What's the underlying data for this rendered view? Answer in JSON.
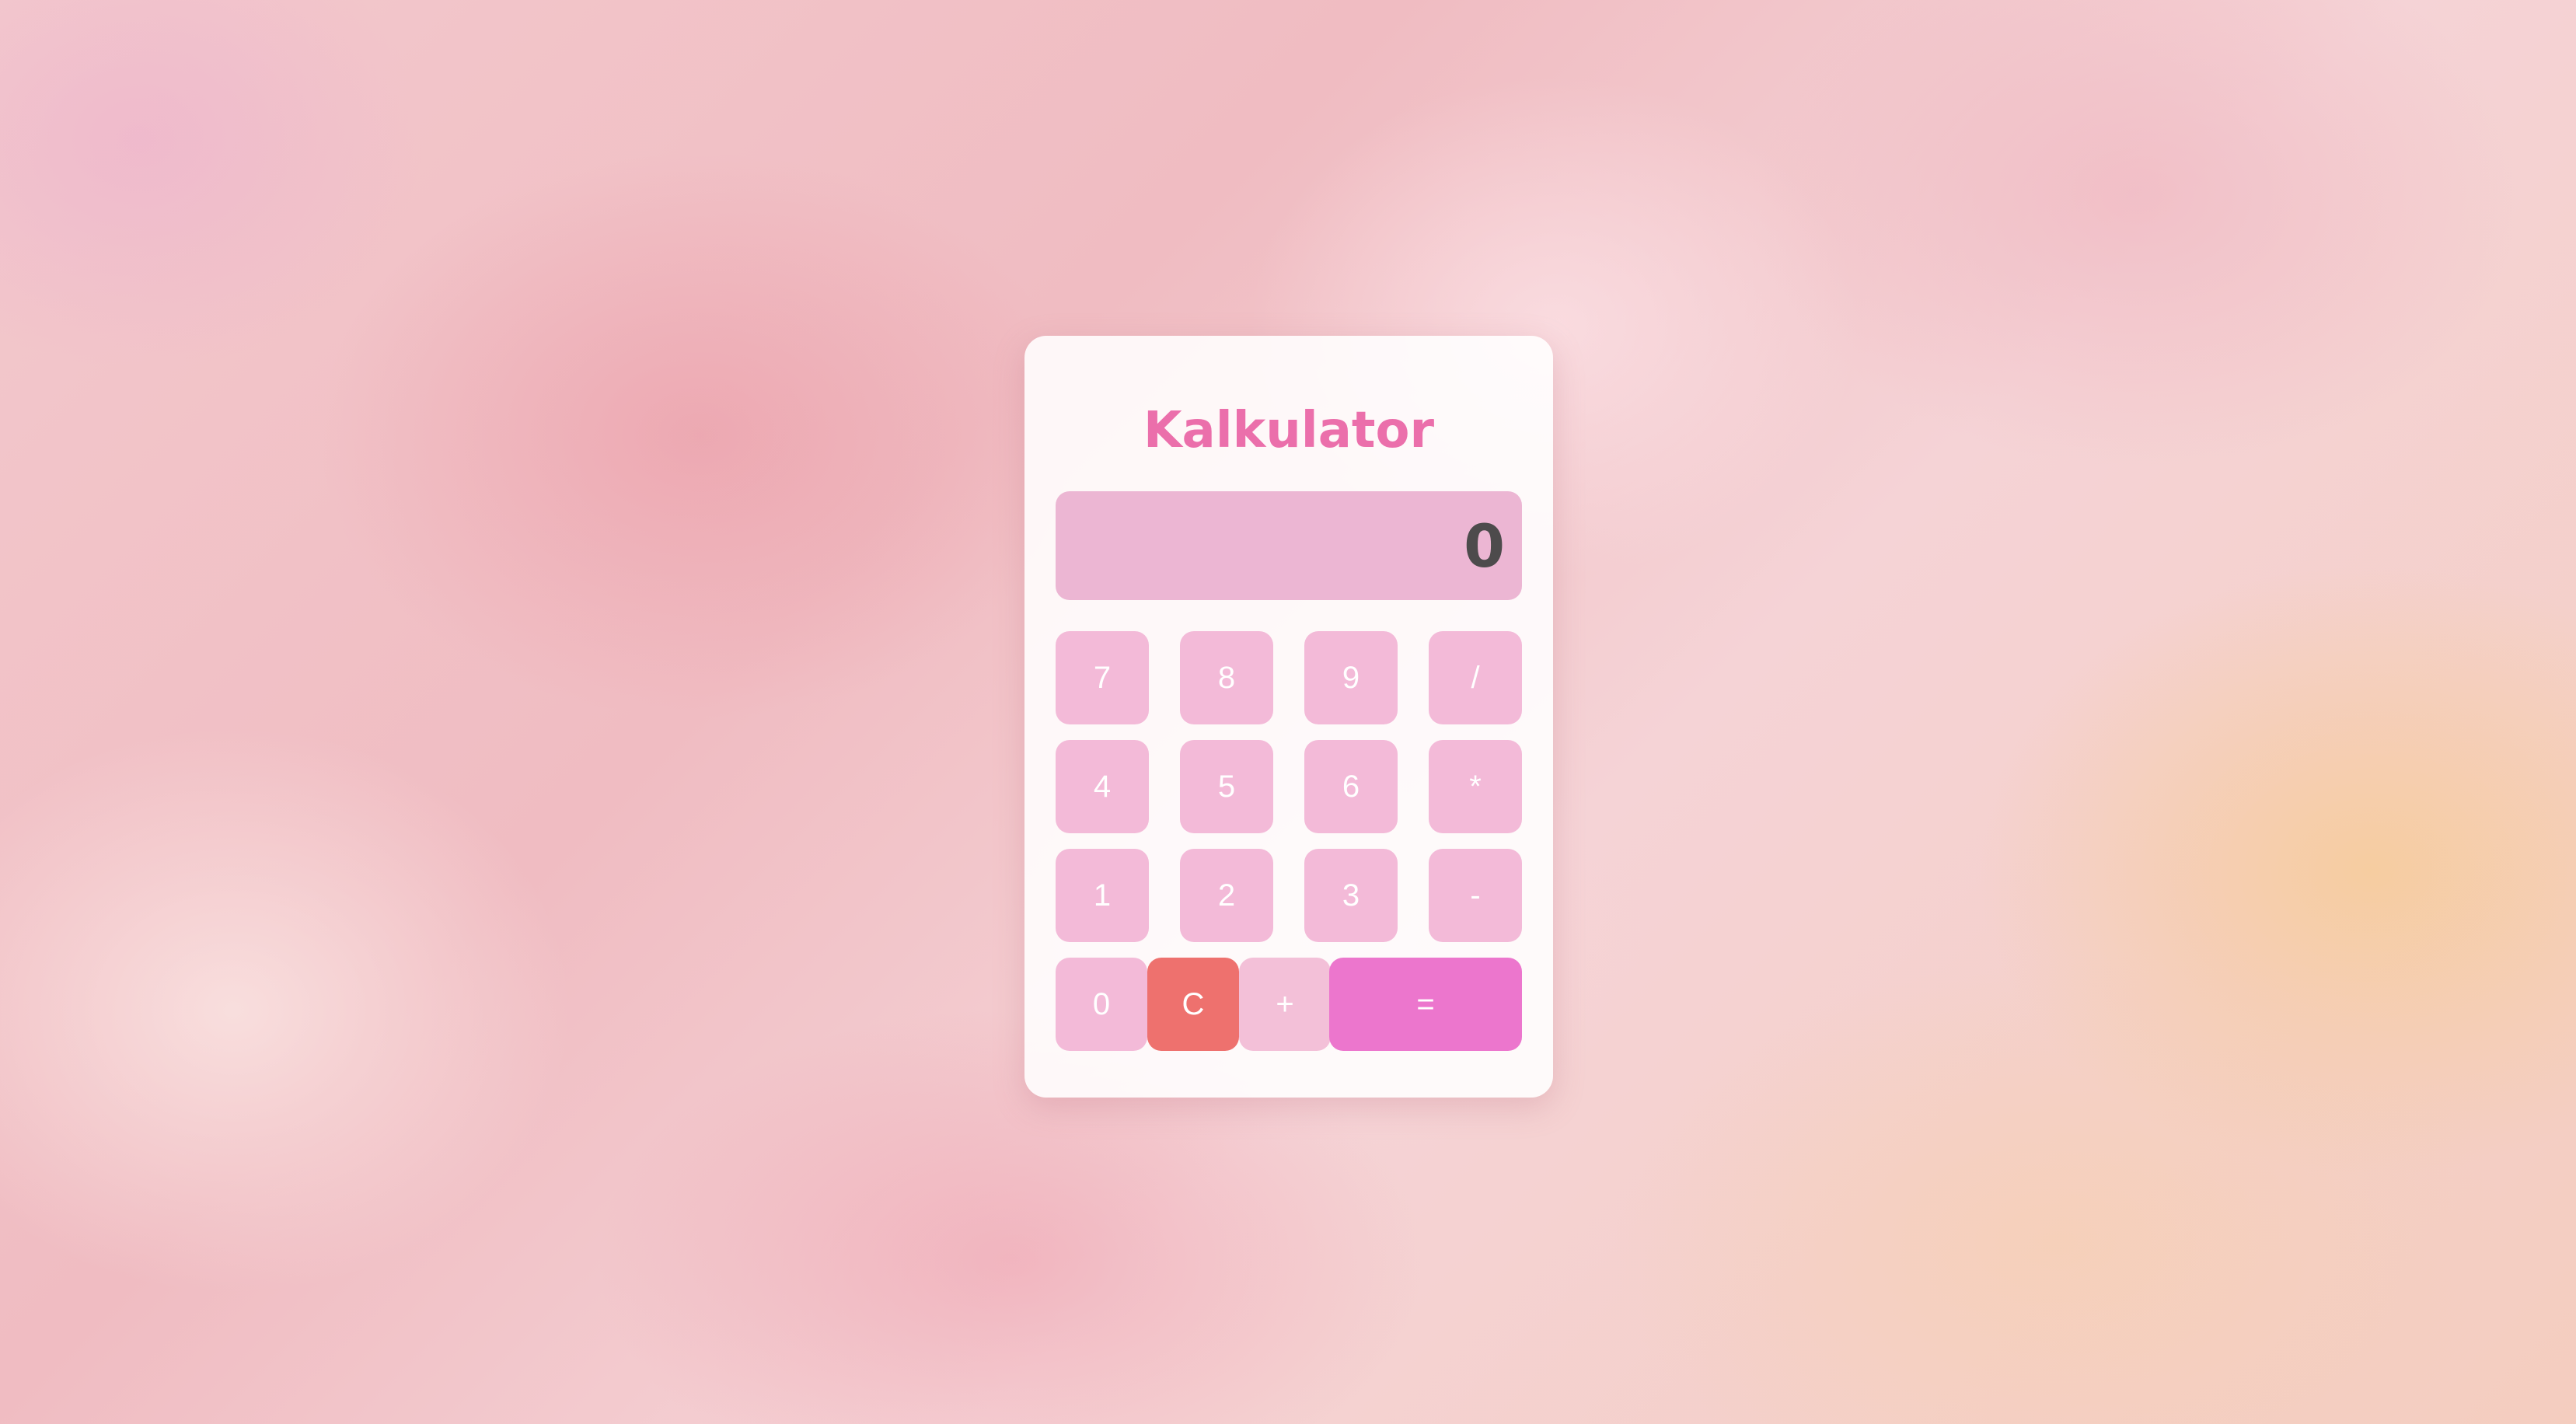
{
  "app": {
    "title": "Kalkulator"
  },
  "display": {
    "value": "0"
  },
  "keys": {
    "seven": "7",
    "eight": "8",
    "nine": "9",
    "divide": "/",
    "four": "4",
    "five": "5",
    "six": "6",
    "multiply": "*",
    "one": "1",
    "two": "2",
    "three": "3",
    "subtract": "-",
    "zero": "0",
    "clear": "C",
    "add": "+",
    "equals": "="
  },
  "colors": {
    "title": "#eb6fab",
    "display_bg": "#ecb6d3",
    "key_bg": "#f3bad8",
    "clear_bg": "#ee716e",
    "equals_bg": "#ec76cd"
  }
}
